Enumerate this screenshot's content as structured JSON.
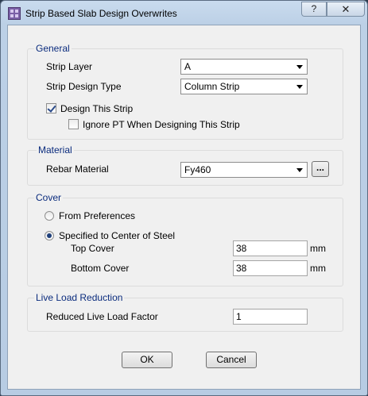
{
  "window": {
    "title": "Strip Based Slab Design Overwrites",
    "help_label": "?",
    "close_label": "✕"
  },
  "general": {
    "title": "General",
    "strip_layer_label": "Strip Layer",
    "strip_layer_value": "A",
    "strip_design_type_label": "Strip Design Type",
    "strip_design_type_value": "Column Strip",
    "design_this_strip_label": "Design This Strip",
    "design_this_strip_checked": true,
    "ignore_pt_label": "Ignore PT When Designing This Strip",
    "ignore_pt_checked": false
  },
  "material": {
    "title": "Material",
    "rebar_material_label": "Rebar Material",
    "rebar_material_value": "Fy460",
    "browse_label": "..."
  },
  "cover": {
    "title": "Cover",
    "from_preferences_label": "From Preferences",
    "specified_label": "Specified to Center of Steel",
    "selected": "specified",
    "top_cover_label": "Top Cover",
    "top_cover_value": "38",
    "bottom_cover_label": "Bottom Cover",
    "bottom_cover_value": "38",
    "unit": "mm"
  },
  "live_load": {
    "title": "Live Load Reduction",
    "factor_label": "Reduced Live Load Factor",
    "factor_value": "1"
  },
  "buttons": {
    "ok": "OK",
    "cancel": "Cancel"
  }
}
